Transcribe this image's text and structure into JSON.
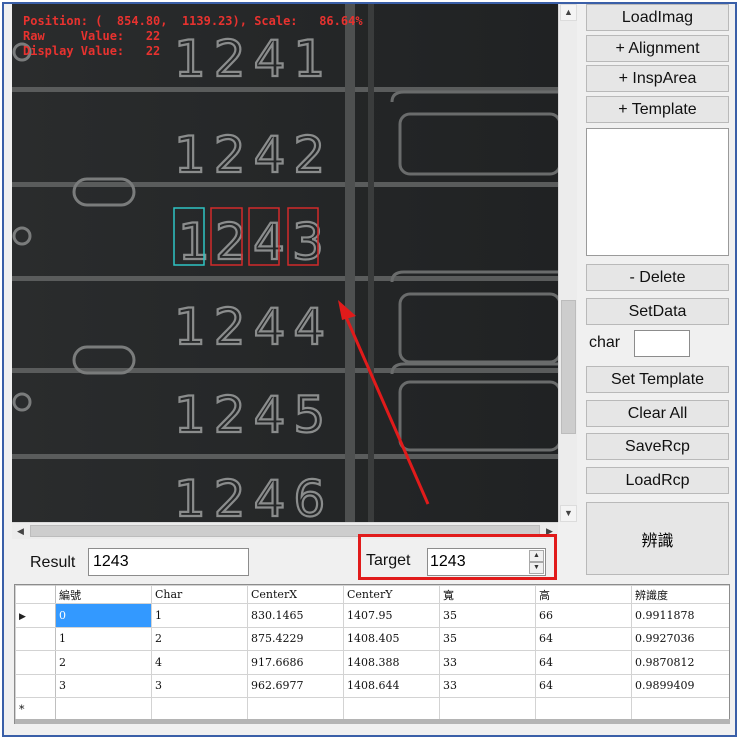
{
  "viewer": {
    "overlay_line1": "Position: (  854.80,  1139.23), Scale:   86.64%",
    "overlay_line2": "Raw     Value:   22",
    "overlay_line3": "Display Value:   22",
    "image_rows": [
      "1241",
      "1242",
      "1243",
      "1244",
      "1245",
      "1246"
    ],
    "target_chars": [
      "1",
      "2",
      "4",
      "3"
    ]
  },
  "panel": {
    "load_image": "LoadImag",
    "alignment": "+ Alignment",
    "insp_area": "+ InspArea",
    "template": "+ Template",
    "delete": "- Delete",
    "set_data": "SetData",
    "char_label": "char",
    "char_value": "",
    "set_template": "Set Template",
    "clear_all": "Clear All",
    "save_rcp": "SaveRcp",
    "load_rcp": "LoadRcp",
    "recognize": "辨識"
  },
  "result": {
    "label": "Result",
    "value": "1243"
  },
  "target": {
    "label": "Target",
    "value": "1243"
  },
  "grid": {
    "headers": [
      "編號",
      "Char",
      "CenterX",
      "CenterY",
      "寬",
      "高",
      "辨識度"
    ],
    "rows": [
      [
        "0",
        "1",
        "830.1465",
        "1407.95",
        "35",
        "66",
        "0.9911878"
      ],
      [
        "1",
        "2",
        "875.4229",
        "1408.405",
        "35",
        "64",
        "0.9927036"
      ],
      [
        "2",
        "4",
        "917.6686",
        "1408.388",
        "33",
        "64",
        "0.9870812"
      ],
      [
        "3",
        "3",
        "962.6977",
        "1408.644",
        "33",
        "64",
        "0.9899409"
      ]
    ],
    "new_row_marker": "*",
    "current_row_marker": "▶"
  },
  "colors": {
    "accent_red": "#e11b1b",
    "selection": "#3399ff",
    "char_match": "#2ec4c4"
  }
}
